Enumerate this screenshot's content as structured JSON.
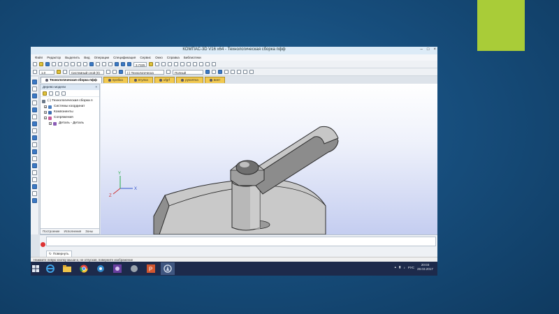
{
  "window": {
    "title": "КОМПАС-3D V16  x64 - Технологическая сборка пфф",
    "controls": [
      "–",
      "□",
      "×"
    ]
  },
  "menu": [
    "Файл",
    "Редактор",
    "Выделить",
    "Вид",
    "Операции",
    "Спецификация",
    "Сервис",
    "Окно",
    "Справка",
    "Библиотеки"
  ],
  "toolbar1": {
    "zoom_value": "3.7325"
  },
  "toolbar2": {
    "step_value": "1.0",
    "layer_value": "Системный слой (0)",
    "assembly_value": "(-) Технологическа",
    "style_value": "Полный"
  },
  "doc_tabs": [
    {
      "label": "Технологическая сборка пфф",
      "active": true
    },
    {
      "label": "пробка",
      "active": false
    },
    {
      "label": "втулка",
      "active": false
    },
    {
      "label": "ufgrf",
      "active": false
    },
    {
      "label": "рукоятка",
      "active": false
    },
    {
      "label": "винт",
      "active": false
    }
  ],
  "tree": {
    "header": "Дерево модели",
    "items": [
      {
        "label": "(-) Технологическая сборка п",
        "level": 0,
        "expand": "",
        "color": "#6c7a8a"
      },
      {
        "label": "Системы координат",
        "level": 1,
        "expand": "+",
        "color": "#4a7fc1"
      },
      {
        "label": "Компоненты",
        "level": 1,
        "expand": "+",
        "color": "#3d6db0"
      },
      {
        "label": "Сопряжения",
        "level": 1,
        "expand": "−",
        "color": "#c75b9a"
      },
      {
        "label": "Деталь - Деталь",
        "level": 2,
        "expand": "+",
        "color": "#8a5bb5"
      }
    ],
    "bottom_tabs": [
      "Построение",
      "Исполнения",
      "Зоны"
    ]
  },
  "properties": {
    "rotate_label": "Повернуть"
  },
  "status_text": "Нажмите левую кнопку мыши и, не отпуская, поверните изображение",
  "taskbar": {
    "apps": [
      "start",
      "ie",
      "explorer",
      "chrome",
      "app4",
      "app5",
      "app6",
      "app7",
      "kompas"
    ],
    "language": "РУС",
    "time": "20:03",
    "date": "28.03.2017"
  },
  "axes": {
    "x": "X",
    "y": "Y",
    "z": "Z"
  },
  "colors": {
    "accent_green": "#a9cc38",
    "background_blue": "#1b5a8c"
  }
}
